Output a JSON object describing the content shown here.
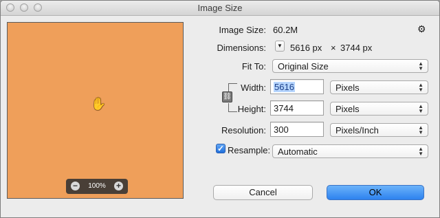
{
  "window": {
    "title": "Image Size"
  },
  "preview": {
    "zoom": "100%",
    "zoom_out": "−",
    "zoom_in": "+",
    "fill_color": "#ef9f5a"
  },
  "image_size": {
    "label": "Image Size:",
    "value": "60.2M"
  },
  "dimensions": {
    "label": "Dimensions:",
    "width": "5616 px",
    "times": "×",
    "height": "3744 px"
  },
  "fit_to": {
    "label": "Fit To:",
    "value": "Original Size"
  },
  "width": {
    "label": "Width:",
    "value": "5616",
    "unit": "Pixels"
  },
  "height": {
    "label": "Height:",
    "value": "3744",
    "unit": "Pixels"
  },
  "resolution": {
    "label": "Resolution:",
    "value": "300",
    "unit": "Pixels/Inch"
  },
  "resample": {
    "label": "Resample:",
    "checked": true,
    "value": "Automatic"
  },
  "buttons": {
    "cancel": "Cancel",
    "ok": "OK"
  },
  "colors": {
    "accent": "#2d82ef"
  }
}
